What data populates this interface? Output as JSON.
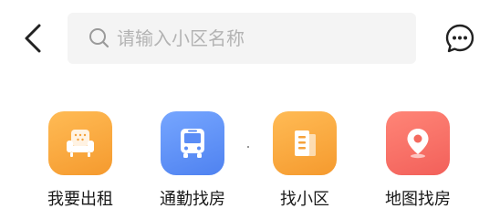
{
  "header": {
    "back_icon": "chevron-left-icon",
    "search": {
      "placeholder": "请输入小区名称",
      "value": "",
      "icon": "search-icon"
    },
    "message_icon": "chat-bubble-icon"
  },
  "shortcuts": [
    {
      "label": "我要出租",
      "icon": "armchair-icon",
      "color": "#F7A23A"
    },
    {
      "label": "通勤找房",
      "icon": "bus-icon",
      "color": "#5B8DF6"
    },
    {
      "label": "找小区",
      "icon": "building-icon",
      "color": "#F7A23A"
    },
    {
      "label": "地图找房",
      "icon": "map-pin-icon",
      "color": "#F46A5F"
    }
  ]
}
